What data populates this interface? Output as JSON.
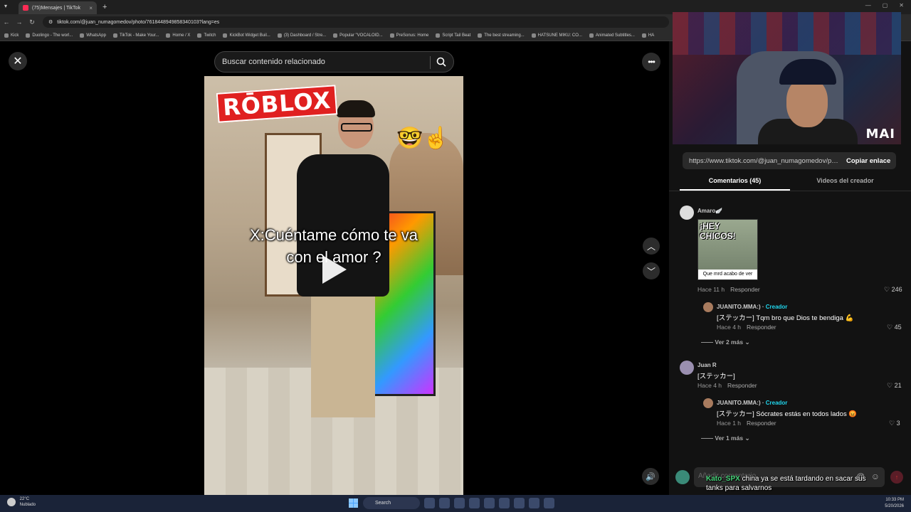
{
  "browser": {
    "tab_title": "(75)Mensajes | TikTok",
    "url": "tiktok.com/@juan_numagomedov/photo/7618448949858340103?lang=es",
    "bookmarks": [
      "Kick",
      "Duolingo - The worl...",
      "WhatsApp",
      "TikTok - Make Your...",
      "Home / X",
      "Twitch",
      "KickBot Widget Buil...",
      "(3) Dashboard / Stre...",
      "Popular \"VOCALOID...",
      "PreSonus: Home",
      "Script Tail Beat",
      "The best streaming...",
      "HATSUNE MIKU: CO...",
      "Animated Subtitles...",
      "HA"
    ]
  },
  "viewer": {
    "search_placeholder": "Buscar contenido relacionado",
    "video": {
      "logo_text": "RŌBLOX",
      "emoji": "🤓☝️",
      "caption_line1": "X:Cuéntame cómo te va",
      "caption_line2": "con el amor ?"
    }
  },
  "panel": {
    "webcam_tag": "MAI",
    "link": "https://www.tiktok.com/@juan_numagomedov/pho...",
    "copy_label": "Copiar enlace",
    "tabs": [
      "Comentarios (45)",
      "Videos del creador"
    ],
    "comments": [
      {
        "user": "Amaro🪽",
        "sticker_top": "¡HEY CHICOS!",
        "sticker_bottom": "Que mrd acabo de ver",
        "time": "Hace 11 h",
        "reply": "Responder",
        "likes": "246",
        "replies": [
          {
            "user": "JUANITO.MMA:)",
            "badge": "Creador",
            "text": "[ステッカー] Tqm bro que Dios te bendiga 💪",
            "time": "Hace 4 h",
            "reply": "Responder",
            "likes": "45"
          }
        ],
        "more": "Ver 2 más"
      },
      {
        "user": "Juan R",
        "text": "[ステッカー]",
        "time": "Hace 4 h",
        "reply": "Responder",
        "likes": "21",
        "replies": [
          {
            "user": "JUANITO.MMA:)",
            "badge": "Creador",
            "text": "[ステッカー] Sócrates estás en todos lados 😡",
            "time": "Hace 1 h",
            "reply": "Responder",
            "likes": "3"
          }
        ],
        "more": "Ver 1 más"
      }
    ],
    "input_placeholder": "Añadir comentario...",
    "chat_overlay": {
      "user": "Kato_SPX",
      "message": "china ya se está tardando en sacar sus tanks para salvarnos"
    }
  },
  "taskbar": {
    "weather_temp": "22°C",
    "weather_desc": "Nublado",
    "search_label": "Search",
    "time": "10:33 PM",
    "date": "5/20/2026"
  }
}
